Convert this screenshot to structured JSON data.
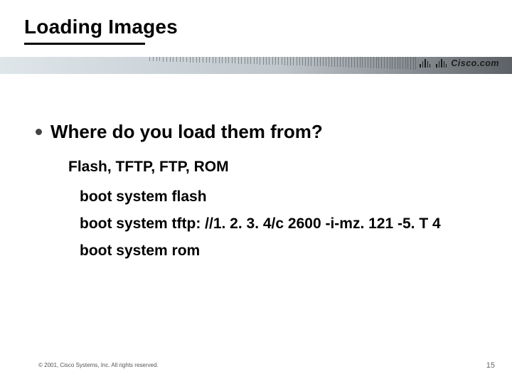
{
  "title": "Loading Images",
  "logo_text": "Cisco.com",
  "bullet_heading": "Where do you load them from?",
  "sub_line": "Flash, TFTP, FTP, ROM",
  "items": [
    "boot system flash",
    "boot system tftp: //1. 2. 3. 4/c 2600 -i-mz. 121 -5. T 4",
    "boot system rom"
  ],
  "footer": "© 2001, Cisco Systems, Inc. All rights reserved.",
  "page_number": "15"
}
